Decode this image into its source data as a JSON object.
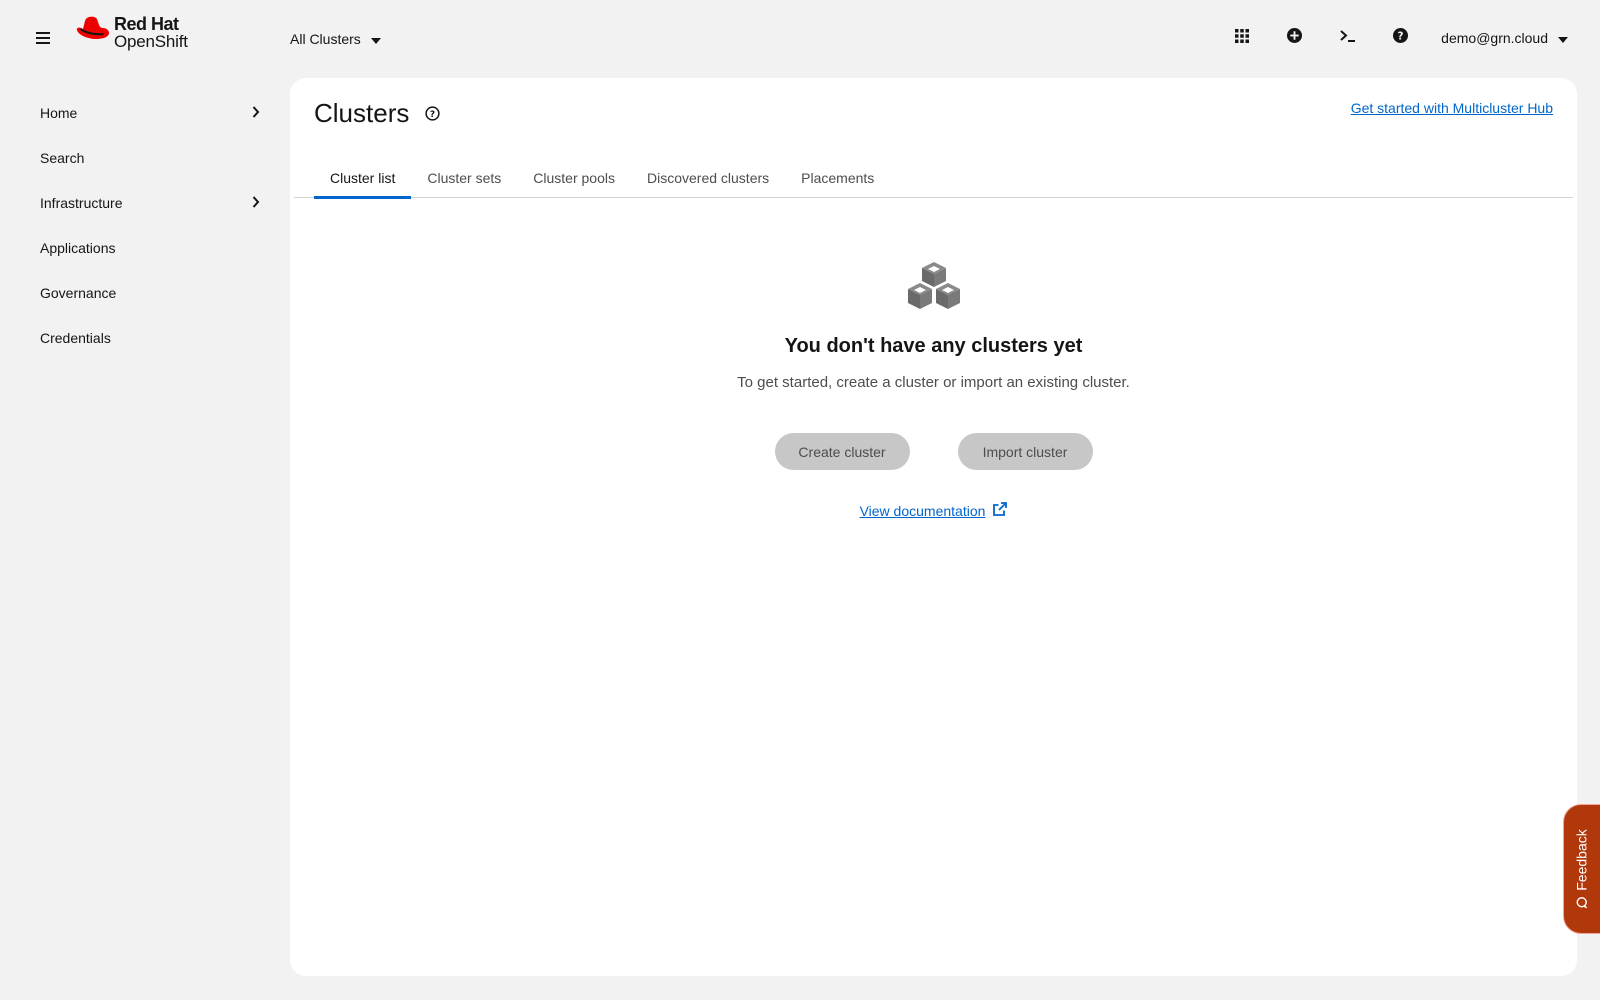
{
  "masthead": {
    "brand": "Red Hat",
    "product": "OpenShift",
    "cluster_switcher": "All Clusters",
    "user": "demo@grn.cloud",
    "tools": [
      "app-launcher-icon",
      "add-icon",
      "terminal-icon",
      "help-icon"
    ]
  },
  "sidebar": {
    "items": [
      {
        "label": "Home",
        "expandable": true
      },
      {
        "label": "Search",
        "expandable": false
      },
      {
        "label": "Infrastructure",
        "expandable": true
      },
      {
        "label": "Applications",
        "expandable": false
      },
      {
        "label": "Governance",
        "expandable": false
      },
      {
        "label": "Credentials",
        "expandable": false
      }
    ]
  },
  "page": {
    "title": "Clusters",
    "hub_link": "Get started with Multicluster Hub",
    "tabs": [
      "Cluster list",
      "Cluster sets",
      "Cluster pools",
      "Discovered clusters",
      "Placements"
    ],
    "active_tab": "Cluster list"
  },
  "empty_state": {
    "icon": "cubes-icon",
    "title": "You don't have any clusters yet",
    "body": "To get started, create a cluster or import an existing cluster.",
    "create_label": "Create cluster",
    "import_label": "Import cluster",
    "doc_link": "View documentation"
  },
  "feedback": {
    "label": "Feedback"
  },
  "colors": {
    "brand_red": "#ee0000",
    "link_blue": "#0066cc",
    "feedback_bg": "#b1380b",
    "disabled_button": "#c7c7c7"
  }
}
